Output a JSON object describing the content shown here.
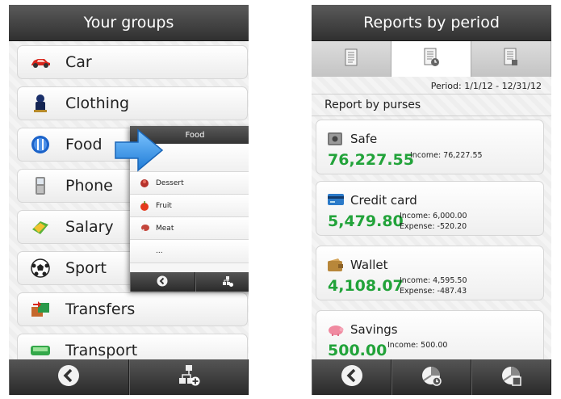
{
  "left": {
    "title": "Your groups",
    "groups": [
      {
        "label": "Car",
        "icon": "car-icon"
      },
      {
        "label": "Clothing",
        "icon": "clothing-icon"
      },
      {
        "label": "Food",
        "icon": "food-icon"
      },
      {
        "label": "Phone",
        "icon": "phone-icon"
      },
      {
        "label": "Salary",
        "icon": "salary-icon"
      },
      {
        "label": "Sport",
        "icon": "soccer-ball-icon"
      },
      {
        "label": "Transfers",
        "icon": "transfers-icon"
      },
      {
        "label": "Transport",
        "icon": "transport-icon"
      }
    ],
    "popup": {
      "title": "Food",
      "items": [
        {
          "label": "Dessert",
          "icon": "dessert-icon"
        },
        {
          "label": "Fruit",
          "icon": "fruit-icon"
        },
        {
          "label": "Meat",
          "icon": "meat-icon"
        },
        {
          "label": "...",
          "icon": ""
        }
      ]
    },
    "bottom": [
      "back-icon",
      "add-group-icon"
    ]
  },
  "right": {
    "title": "Reports by period",
    "tabs": [
      "report-list-icon",
      "report-period-icon",
      "report-grid-icon"
    ],
    "period": "Period: 1/1/12 - 12/31/12",
    "section": "Report by purses",
    "purses": [
      {
        "name": "Safe",
        "amount": "76,227.55",
        "income": "Income: 76,227.55",
        "expense": "",
        "icon": "safe-icon"
      },
      {
        "name": "Credit card",
        "amount": "5,479.80",
        "income": "Income: 6,000.00",
        "expense": "Expense: -520.20",
        "icon": "credit-card-icon"
      },
      {
        "name": "Wallet",
        "amount": "4,108.07",
        "income": "Income: 4,595.50",
        "expense": "Expense: -487.43",
        "icon": "wallet-icon"
      },
      {
        "name": "Savings",
        "amount": "500.00",
        "income": "Income: 500.00",
        "expense": "",
        "icon": "piggy-bank-icon"
      }
    ],
    "bottom": [
      "back-icon",
      "chart-icon",
      "chart-add-icon"
    ]
  },
  "colors": {
    "amount": "#22a33a",
    "arrow": "#2f8fe0"
  }
}
